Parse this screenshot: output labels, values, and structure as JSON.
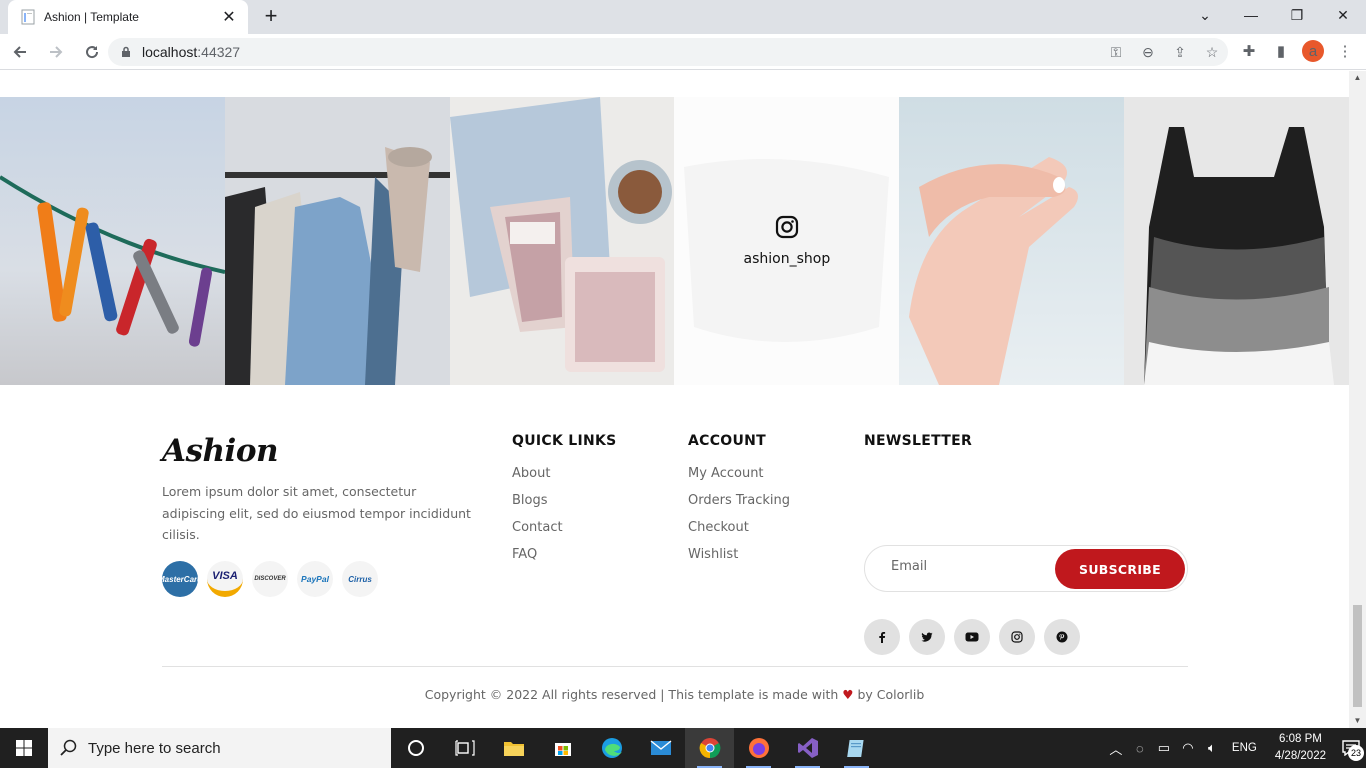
{
  "browser": {
    "tab_title": "Ashion | Template",
    "url_host": "localhost",
    "url_port": ":44327",
    "avatar_letter": "a"
  },
  "instagram": {
    "handle": "ashion_shop"
  },
  "footer": {
    "logo": "Ashion",
    "about": "Lorem ipsum dolor sit amet, consectetur adipiscing elit, sed do eiusmod tempor incididunt cilisis.",
    "payments": [
      "MasterCard",
      "VISA",
      "DISCOVER",
      "PayPal",
      "Cirrus"
    ],
    "quick_links": {
      "title": "QUICK LINKS",
      "items": [
        "About",
        "Blogs",
        "Contact",
        "FAQ"
      ]
    },
    "account": {
      "title": "ACCOUNT",
      "items": [
        "My Account",
        "Orders Tracking",
        "Checkout",
        "Wishlist"
      ]
    },
    "newsletter": {
      "title": "NEWSLETTER",
      "email_placeholder": "Email",
      "subscribe_label": "SUBSCRIBE"
    },
    "socials": [
      "facebook-icon",
      "twitter-icon",
      "youtube-icon",
      "instagram-icon",
      "pinterest-icon"
    ],
    "copyright_pre": "Copyright © 2022 All rights reserved | This template is made with ",
    "copyright_post": " by Colorlib",
    "accent_color": "#c0181d"
  },
  "taskbar": {
    "search_placeholder": "Type here to search",
    "language": "ENG",
    "time": "6:08 PM",
    "date": "4/28/2022",
    "notification_count": "23"
  }
}
